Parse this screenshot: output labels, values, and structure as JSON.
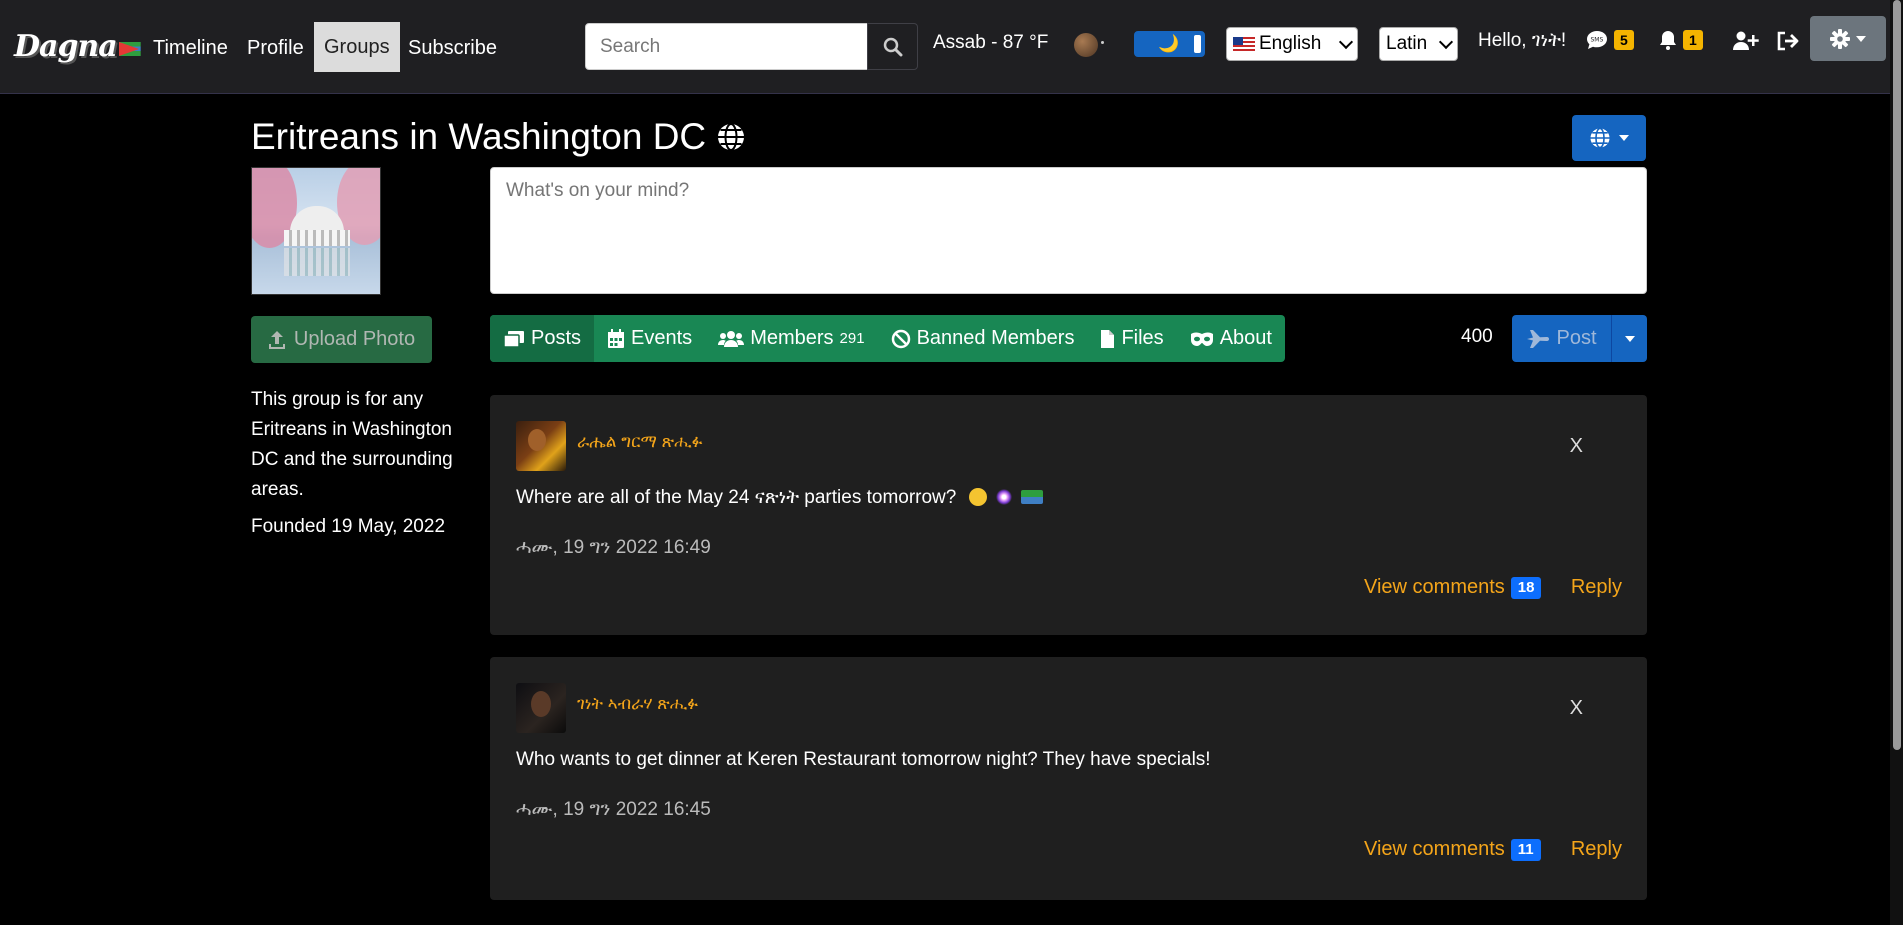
{
  "brand": {
    "logo_text": "Dagna"
  },
  "nav": {
    "links": [
      "Timeline",
      "Profile",
      "Groups",
      "Subscribe"
    ],
    "search_placeholder": "Search",
    "weather": "Assab - 87 °F",
    "language": "English",
    "script": "Latin",
    "greeting": "Hello, ገነት!",
    "messages_count": "5",
    "notifications_count": "1"
  },
  "group": {
    "title": "Eritreans in Washington DC",
    "upload_label": "Upload Photo",
    "description": "This group is for any Eritreans in Washington DC and the surrounding areas.",
    "founded": "Founded 19 May, 2022"
  },
  "composer": {
    "placeholder": "What's on your mind?",
    "char_count": "400",
    "post_label": "Post"
  },
  "tabs": [
    {
      "label": "Posts",
      "icon": "posts-icon"
    },
    {
      "label": "Events",
      "icon": "calendar-icon"
    },
    {
      "label": "Members",
      "icon": "users-icon",
      "count": "291"
    },
    {
      "label": "Banned Members",
      "icon": "ban-icon"
    },
    {
      "label": "Files",
      "icon": "file-icon"
    },
    {
      "label": "About",
      "icon": "mask-icon"
    }
  ],
  "posts": [
    {
      "author": "ራሔል ግርማ ጽሒፉ",
      "text": "Where are all of the May 24 ናጽነት parties tomorrow?",
      "date": "ሓሙ, 19 ግን 2022 16:49",
      "view_comments": "View comments",
      "comment_count": "18",
      "reply": "Reply",
      "close": "X"
    },
    {
      "author": "ገነት ኣብራሃ ጽሒፉ",
      "text": "Who wants to get dinner at Keren Restaurant tomorrow night? They have specials!",
      "date": "ሓሙ, 19 ግን 2022 16:45",
      "view_comments": "View comments",
      "comment_count": "11",
      "reply": "Reply",
      "close": "X"
    }
  ],
  "colors": {
    "accent_orange": "#f4a51a",
    "green_tabs": "#198754",
    "blue_primary": "#1565c0",
    "badge_yellow": "#f4b400"
  }
}
